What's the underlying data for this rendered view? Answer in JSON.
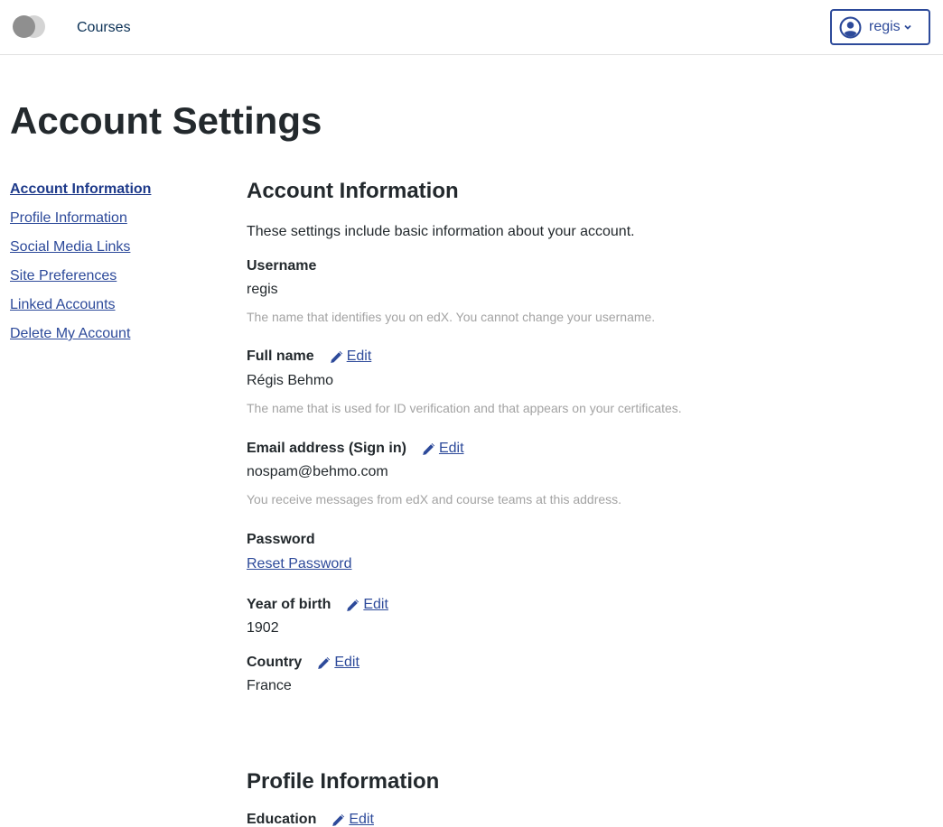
{
  "header": {
    "logo_icon": "edx-logo-icon",
    "nav_courses": "Courses",
    "user": {
      "avatar_icon": "user-circle-icon",
      "username": "regis",
      "chevron_icon": "chevron-down-icon"
    }
  },
  "page_title": "Account Settings",
  "sidebar": {
    "items": [
      {
        "label": "Account Information",
        "active": true
      },
      {
        "label": "Profile Information",
        "active": false
      },
      {
        "label": "Social Media Links",
        "active": false
      },
      {
        "label": "Site Preferences",
        "active": false
      },
      {
        "label": "Linked Accounts",
        "active": false
      },
      {
        "label": "Delete My Account",
        "active": false
      }
    ]
  },
  "account": {
    "title": "Account Information",
    "description": "These settings include basic information about your account.",
    "edit_label": "Edit",
    "edit_icon": "pencil-icon",
    "username": {
      "label": "Username",
      "value": "regis",
      "help": "The name that identifies you on edX. You cannot change your username."
    },
    "full_name": {
      "label": "Full name",
      "value": "Régis Behmo",
      "help": "The name that is used for ID verification and that appears on your certificates."
    },
    "email": {
      "label": "Email address (Sign in)",
      "value": "nospam@behmo.com",
      "help": "You receive messages from edX and course teams at this address."
    },
    "password": {
      "label": "Password",
      "reset_label": "Reset Password"
    },
    "year_of_birth": {
      "label": "Year of birth",
      "value": "1902"
    },
    "country": {
      "label": "Country",
      "value": "France"
    }
  },
  "profile": {
    "title": "Profile Information",
    "education": {
      "label": "Education"
    }
  },
  "colors": {
    "link": "#2d4a9a",
    "text": "#23292d",
    "muted": "#a3a3a3",
    "divider": "#e1e1e1"
  }
}
